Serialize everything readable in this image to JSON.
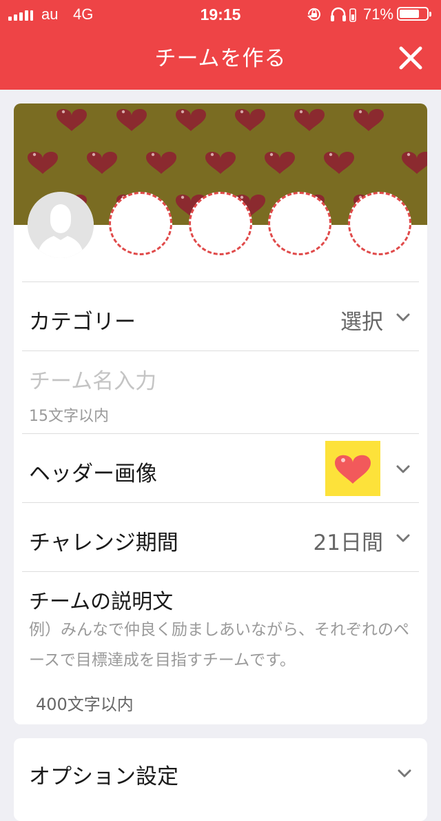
{
  "status_bar": {
    "carrier": "au",
    "network": "4G",
    "time": "19:15",
    "battery_percent": "71%",
    "battery_level": 0.71
  },
  "nav": {
    "title": "チームを作る",
    "close_icon": "close-icon"
  },
  "header_image": {
    "pattern_icon": "heart-icon",
    "background_color": "#7a6c22",
    "heart_color": "#8b2a2f",
    "member_slots": 4
  },
  "form": {
    "category": {
      "label": "カテゴリー",
      "value": "選択"
    },
    "team_name": {
      "placeholder": "チーム名入力",
      "hint": "15文字以内"
    },
    "header_image": {
      "label": "ヘッダー画像",
      "thumb_icon": "heart-icon",
      "thumb_bg": "#fde23a"
    },
    "challenge_period": {
      "label": "チャレンジ期間",
      "value": "21日間"
    },
    "description": {
      "label": "チームの説明文",
      "placeholder": "例）みんなで仲良く励ましあいながら、それぞれのペースで目標達成を目指すチームです。",
      "limit": "400文字以内"
    }
  },
  "options": {
    "label": "オプション設定"
  },
  "colors": {
    "accent": "#ee4446",
    "background": "#efeff4",
    "dashed": "#e04a4a"
  }
}
